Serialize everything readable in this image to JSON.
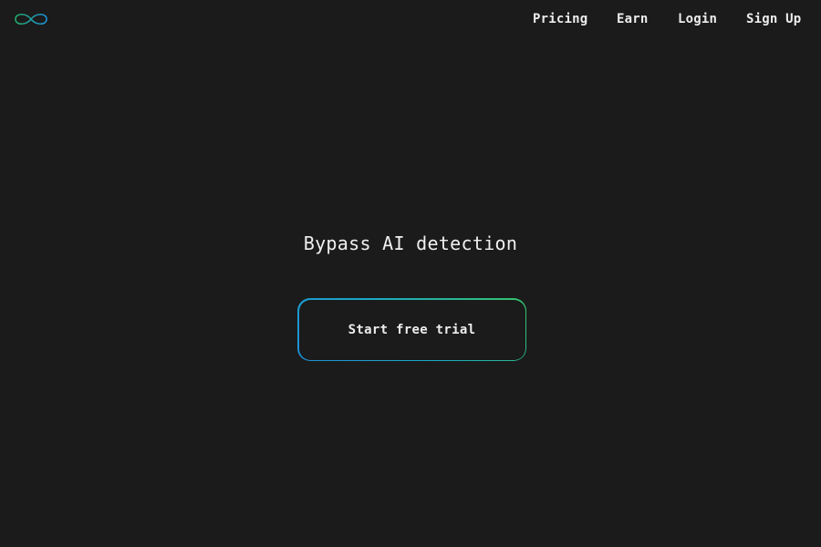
{
  "header": {
    "logo_icon": "infinity-icon",
    "logo_colors": [
      "#1e90d6",
      "#35c46a"
    ],
    "nav": {
      "pricing": "Pricing",
      "earn": "Earn",
      "login": "Login",
      "signup": "Sign Up"
    }
  },
  "hero": {
    "title": "Bypass AI detection",
    "cta_label": "Start free trial"
  },
  "colors": {
    "background": "#1b1b1b",
    "text": "#ececec",
    "gradient_start": "#1e90d6",
    "gradient_end": "#35c46a"
  }
}
